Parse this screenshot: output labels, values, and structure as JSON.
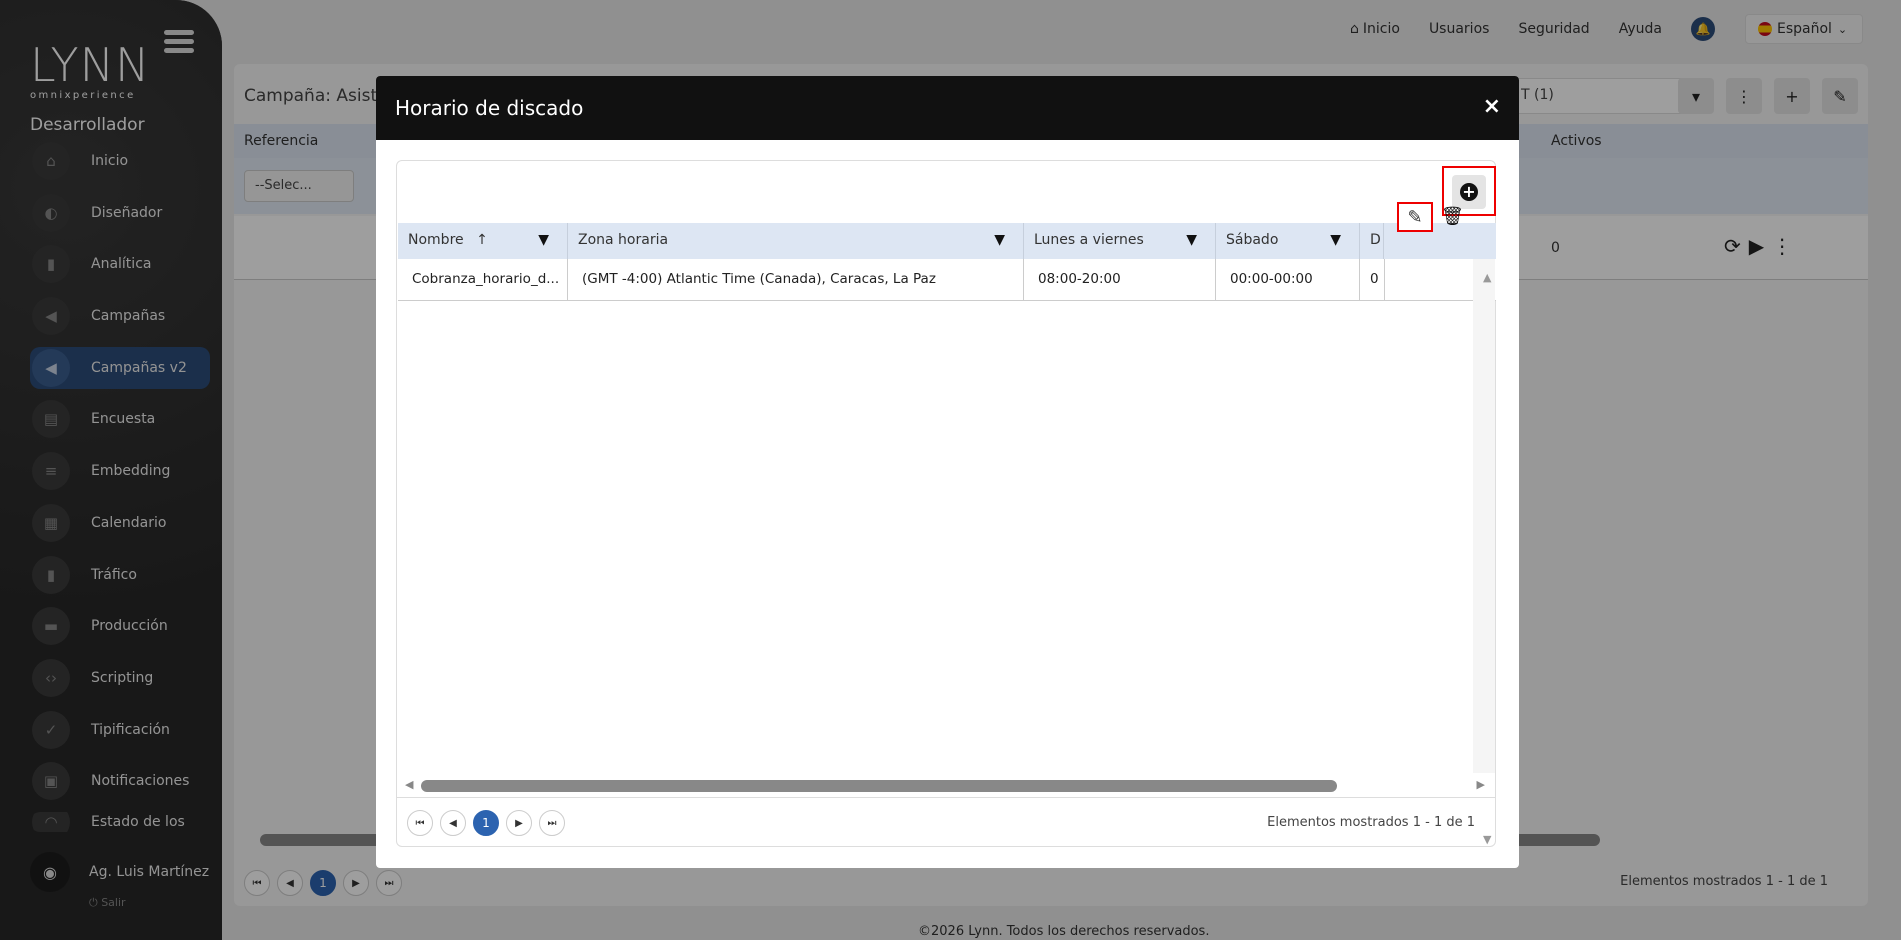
{
  "sidebar": {
    "logo_word": "LYNN",
    "logo_sub": "omnixperience",
    "role": "Desarrollador",
    "items": [
      {
        "label": "Inicio",
        "icon": "⌂"
      },
      {
        "label": "Diseñador",
        "icon": "◐"
      },
      {
        "label": "Analítica",
        "icon": "▮"
      },
      {
        "label": "Campañas",
        "icon": "◀"
      },
      {
        "label": "Campañas v2",
        "icon": "◀"
      },
      {
        "label": "Encuesta",
        "icon": "▤"
      },
      {
        "label": "Embedding",
        "icon": "≡"
      },
      {
        "label": "Calendario",
        "icon": "▦"
      },
      {
        "label": "Tráfico",
        "icon": "▮"
      },
      {
        "label": "Producción",
        "icon": "▬"
      },
      {
        "label": "Scripting",
        "icon": "‹›"
      },
      {
        "label": "Tipificación",
        "icon": "✓"
      },
      {
        "label": "Notificaciones",
        "icon": "▣"
      },
      {
        "label": "Estado de los",
        "icon": "◠"
      }
    ],
    "user_name": "Ag. Luis Martínez",
    "user_icon": "◉",
    "logout": "⏻ Salir"
  },
  "topnav": {
    "inicio": "Inicio",
    "usuarios": "Usuarios",
    "seguridad": "Seguridad",
    "ayuda": "Ayuda",
    "language": "Español"
  },
  "main": {
    "title": "Campaña: Asiste",
    "input_value": "T (1)",
    "col_referencia": "Referencia",
    "col_activos": "Activos",
    "select_value": "--Selec...",
    "row_activos": "0",
    "pager_page": "1",
    "count": "Elementos mostrados 1 - 1 de 1"
  },
  "footer": "©2026 Lynn. Todos los derechos reservados.",
  "modal": {
    "title": "Horario de discado",
    "close": "×",
    "columns": {
      "nombre": "Nombre",
      "zona": "Zona horaria",
      "lunes": "Lunes a viernes",
      "sabado": "Sábado",
      "domingo": "D"
    },
    "row": {
      "nombre": "Cobranza_horario_d...",
      "zona": "(GMT -4:00) Atlantic Time (Canada), Caracas, La Paz",
      "lunes": "08:00-20:00",
      "sabado": "00:00-00:00",
      "domingo": "0"
    },
    "pager_page": "1",
    "count": "Elementos mostrados 1 - 1 de 1"
  }
}
